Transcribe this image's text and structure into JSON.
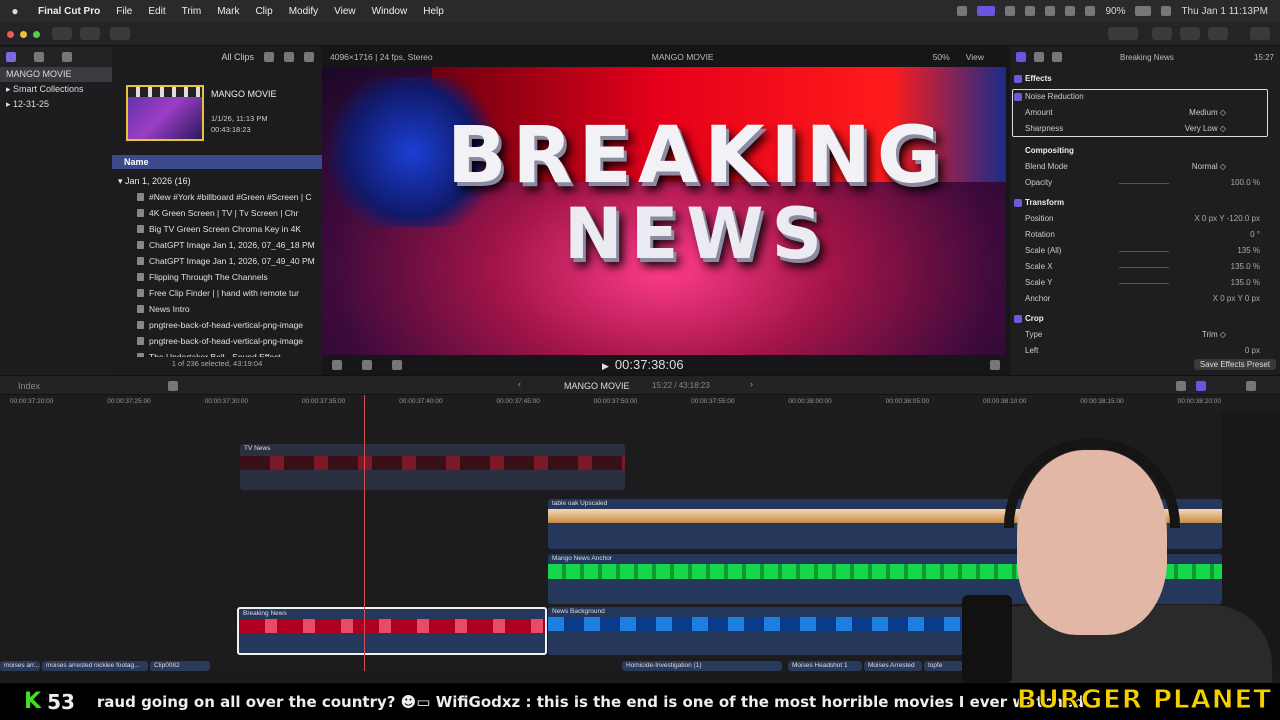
{
  "menubar": {
    "app": "Final Cut Pro",
    "items": [
      "File",
      "Edit",
      "Trim",
      "Mark",
      "Clip",
      "Modify",
      "View",
      "Window",
      "Help"
    ],
    "battery": "90%",
    "datetime": "Thu Jan 1  11:13PM"
  },
  "libraries": {
    "filter": "All Clips",
    "items": [
      {
        "label": "MANGO MOVIE",
        "sel": true
      },
      {
        "label": "▸  Smart Collections"
      },
      {
        "label": "▸  12-31-25"
      }
    ]
  },
  "browser": {
    "event_title": "MANGO MOVIE",
    "event_date": "1/1/26, 11:13 PM",
    "event_duration": "00:43:18:23",
    "column": "Name",
    "group": "Jan 1, 2026  (16)",
    "clips": [
      "#New #York #billboard #Green #Screen | C",
      "4K Green Screen  |  TV  |  Tv Screen  | Chr",
      "Big TV Green Screen Chroma Key in 4K",
      "ChatGPT Image Jan 1, 2026, 07_46_18 PM",
      "ChatGPT Image Jan 1, 2026, 07_49_40 PM",
      "Flipping Through The Channels",
      "Free Clip  Finder  |  |  hand with remote tur",
      "News Intro",
      "pngtree-back-of-head-vertical-png-image",
      "pngtree-back-of-head-vertical-png-image",
      "The Undertaker Bell - Sound Effect"
    ],
    "footer": "1 of 236 selected, 43:19:04"
  },
  "viewer": {
    "format": "4096×1716 | 24 fps, Stereo",
    "title": "MANGO MOVIE",
    "zoom": "50%",
    "view": "View",
    "line1": "BREAKING",
    "line2": "NEWS",
    "timecode": "00:37:38:06"
  },
  "inspector": {
    "title": "Breaking News",
    "duration": "15:27",
    "effects": "Effects",
    "noise": "Noise Reduction",
    "amount_label": "Amount",
    "amount": "Medium ◇",
    "sharp_label": "Sharpness",
    "sharp": "Very Low ◇",
    "compositing": "Compositing",
    "blend_label": "Blend Mode",
    "blend": "Normal ◇",
    "opacity_label": "Opacity",
    "opacity": "100.0 %",
    "transform": "Transform",
    "pos_label": "Position",
    "pos": "X      0 px   Y  -120.0 px",
    "rot_label": "Rotation",
    "rot": "0 °",
    "scale_all_label": "Scale (All)",
    "scale_all": "135 %",
    "scale_x_label": "Scale X",
    "scale_x": "135.0 %",
    "scale_y_label": "Scale Y",
    "scale_y": "135.0 %",
    "anchor_label": "Anchor",
    "anchor": "X      0 px   Y      0 px",
    "crop": "Crop",
    "type_label": "Type",
    "type": "Trim ◇",
    "left_label": "Left",
    "left": "0 px",
    "save": "Save Effects Preset"
  },
  "timeline": {
    "index": "Index",
    "project": "MANGO MOVIE",
    "position": "15:22 / 43:18:23",
    "ticks": [
      "00:00:37:20:00",
      "00:00:37:25:00",
      "00:00:37:30:00",
      "00:00:37:35:00",
      "00:00:37:40:00",
      "00:00:37:45:00",
      "00:00:37:50:00",
      "00:00:37:55:00",
      "00:00:38:00:00",
      "00:00:38:05:00",
      "00:00:38:10:00",
      "00:00:38:15:00",
      "00:00:38:20:00"
    ],
    "clips": {
      "tv": "TV News",
      "table": "table oak Upscaled",
      "anchor": "Mango News Anchor",
      "breaking": "Breaking News",
      "background": "News Background",
      "c1": "moises arr...",
      "c2": "moises arrested nicklee footag...",
      "c3": "Clip0082",
      "c4": "Homicide-Investigation (1)",
      "c5": "Moises Headshot 1",
      "c6": "Moises Arrested",
      "c7": "topfe"
    }
  },
  "ticker": {
    "k": "K",
    "count": "53",
    "message": "raud going on all over the country?  ☻▭  WifiGodxz : this is the end is one of the most horrible movies I ever watched",
    "brand": "BURGER PLANET"
  }
}
